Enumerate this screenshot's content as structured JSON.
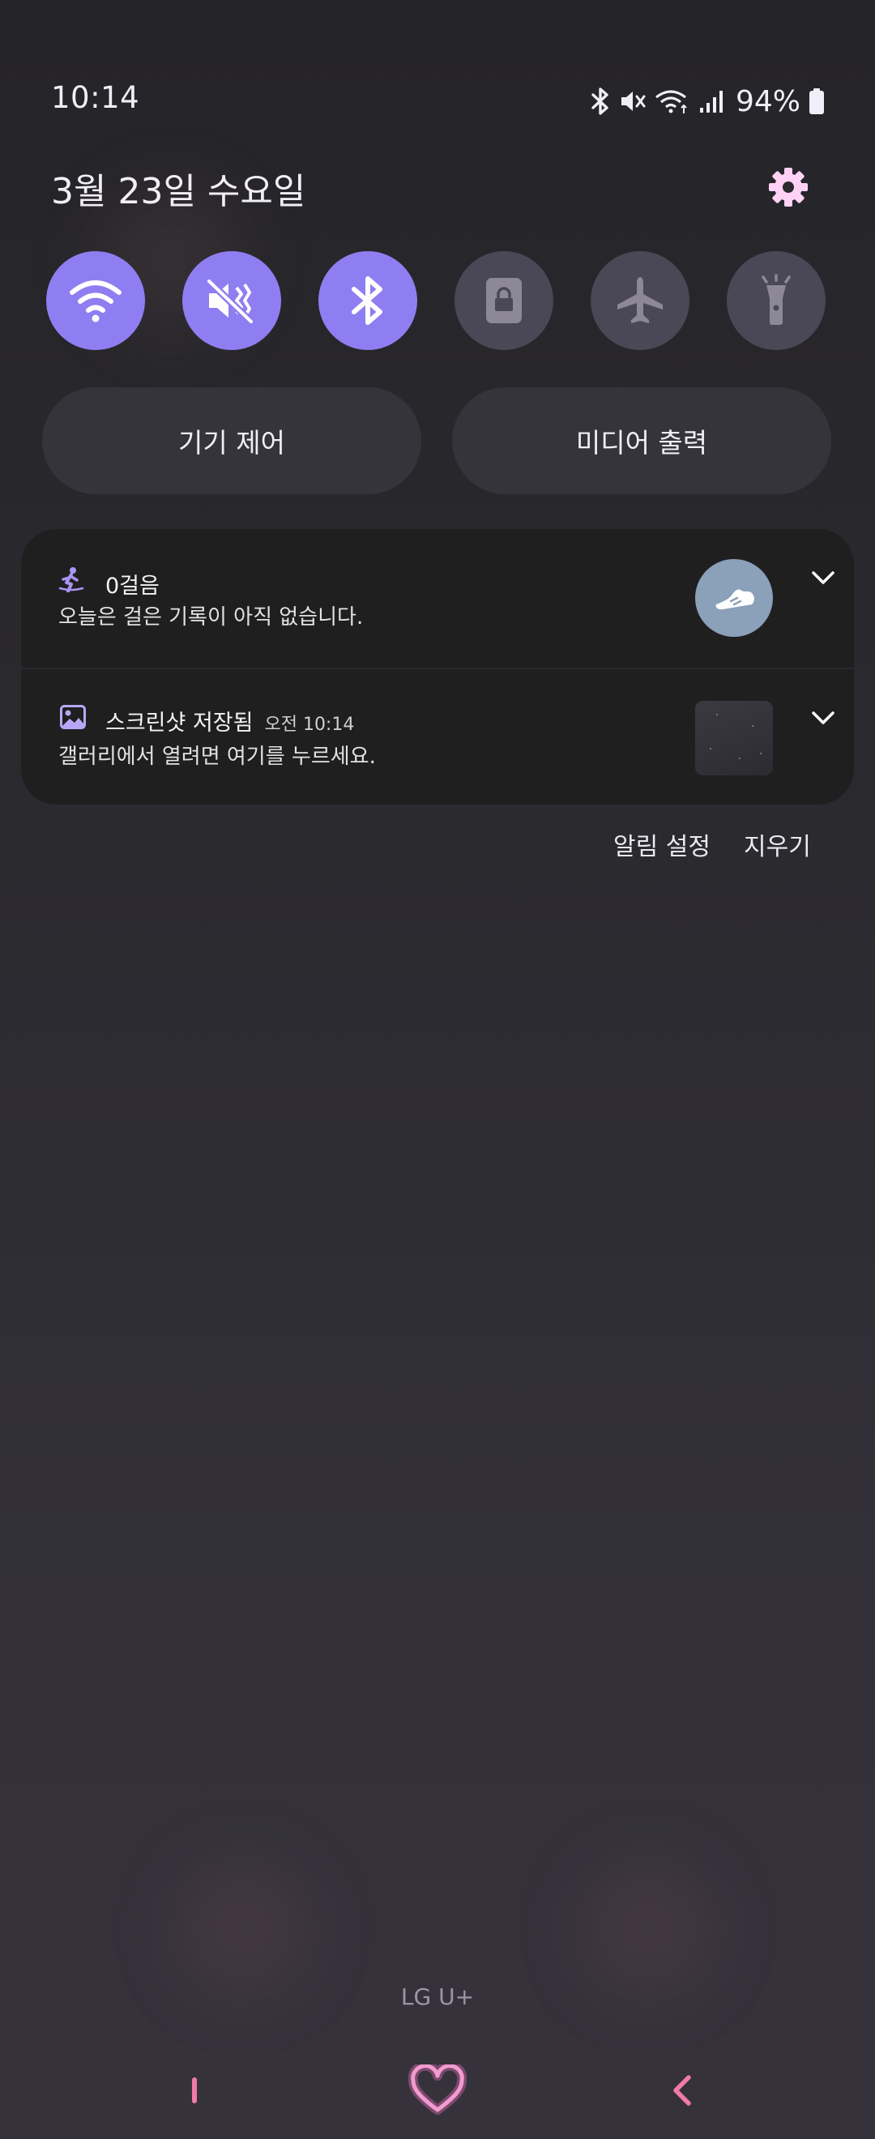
{
  "status_bar": {
    "time": "10:14",
    "battery_pct": "94%",
    "icons": [
      "bluetooth-icon",
      "mute-icon",
      "wifi-icon",
      "signal-icon",
      "battery-icon"
    ]
  },
  "header": {
    "date": "3월 23일 수요일",
    "settings_icon": "gear-icon"
  },
  "quick_settings": [
    {
      "name": "wifi",
      "icon": "wifi-icon",
      "state": "on"
    },
    {
      "name": "sound",
      "icon": "mute-icon",
      "state": "on"
    },
    {
      "name": "bluetooth",
      "icon": "bluetooth-icon",
      "state": "on"
    },
    {
      "name": "screen-lock",
      "icon": "lock-icon",
      "state": "off"
    },
    {
      "name": "airplane-mode",
      "icon": "airplane-icon",
      "state": "off"
    },
    {
      "name": "flashlight",
      "icon": "flashlight-icon",
      "state": "off"
    }
  ],
  "controls": {
    "device_control": "기기 제어",
    "media_output": "미디어 출력"
  },
  "notifications": [
    {
      "app_icon": "running-person-icon",
      "title": "0걸음",
      "time": "",
      "body": "오늘은 걸은 기록이 아직 없습니다.",
      "thumb_icon": "shoe-icon"
    },
    {
      "app_icon": "gallery-icon",
      "title": "스크린샷 저장됨",
      "time": "오전 10:14",
      "body": "갤러리에서 열려면 여기를 누르세요.",
      "thumb_icon": "screenshot-thumbnail"
    }
  ],
  "notification_actions": {
    "settings": "알림 설정",
    "clear": "지우기"
  },
  "carrier": "LG U+",
  "nav": {
    "icons": [
      "recents-icon",
      "home-heart-icon",
      "back-icon"
    ]
  },
  "colors": {
    "toggle_on": "#8f7ef1",
    "toggle_off": "#4a4756",
    "accent": "#ffd2f5",
    "nav_pink": "#f27aa8"
  }
}
